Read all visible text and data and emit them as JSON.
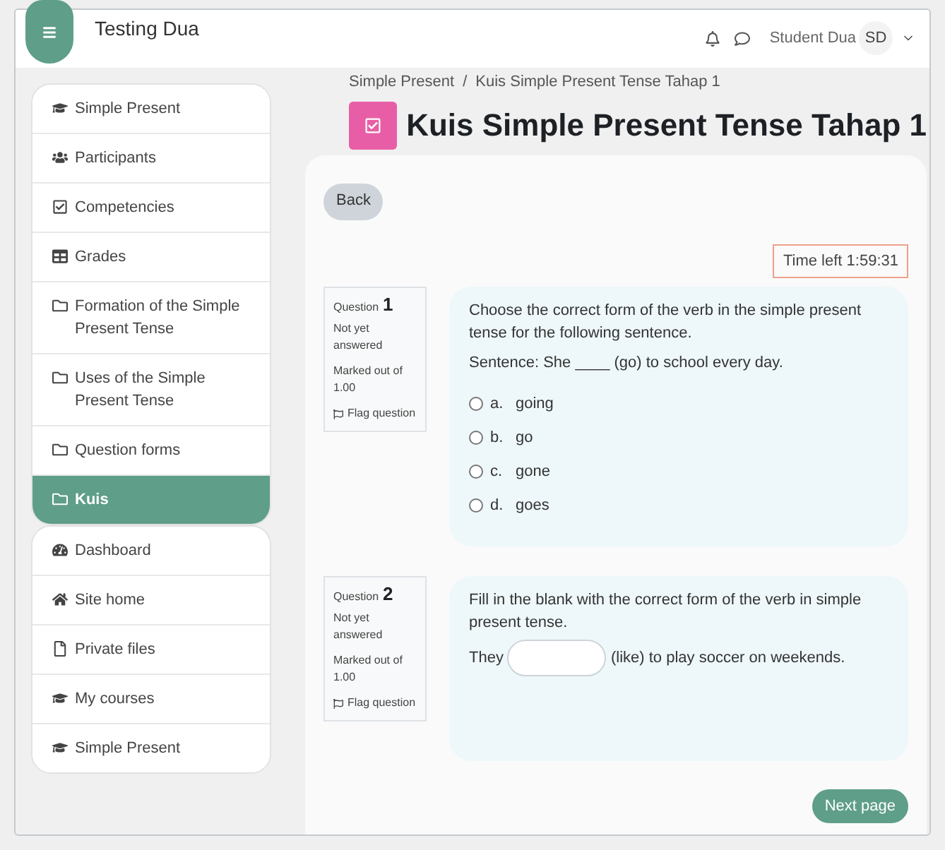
{
  "header": {
    "site_name": "Testing Dua",
    "user_name": "Student Dua",
    "user_initials": "SD"
  },
  "sidebar": {
    "course_items": [
      {
        "label": "Simple Present",
        "selected": false
      },
      {
        "label": "Participants",
        "selected": false
      },
      {
        "label": "Competencies",
        "selected": false
      },
      {
        "label": "Grades",
        "selected": false
      },
      {
        "label": "Formation of the Simple Present Tense",
        "selected": false
      },
      {
        "label": "Uses of the Simple Present Tense",
        "selected": false
      },
      {
        "label": "Question forms",
        "selected": false
      },
      {
        "label": "Kuis",
        "selected": true
      }
    ],
    "site_items": [
      {
        "label": "Dashboard",
        "selected": false
      },
      {
        "label": "Site home",
        "selected": false
      },
      {
        "label": "Private files",
        "selected": false
      },
      {
        "label": "My courses",
        "selected": false
      },
      {
        "label": "Simple Present",
        "selected": false
      }
    ]
  },
  "breadcrumb": [
    "Simple Present",
    "Kuis Simple Present Tense Tahap 1"
  ],
  "breadcrumb_separator": "/",
  "page_title": "Kuis Simple Present Tense Tahap 1",
  "back_button": "Back",
  "timer": "Time left 1:59:31",
  "questions": [
    {
      "kind": "choice",
      "label": "Question",
      "number": "1",
      "status": "Not yet answered",
      "marks": "Marked out of 1.00",
      "flag": "Flag question",
      "text": "Choose the correct form of the verb in the simple present tense for the following sentence.",
      "sentence": "Sentence: She ____ (go) to school every day.",
      "options": [
        {
          "letter": "a.",
          "text": "going",
          "selected": false
        },
        {
          "letter": "b.",
          "text": "go",
          "selected": false
        },
        {
          "letter": "c.",
          "text": "gone",
          "selected": false
        },
        {
          "letter": "d.",
          "text": "goes",
          "selected": false
        }
      ]
    },
    {
      "kind": "fill",
      "label": "Question",
      "number": "2",
      "status": "Not yet answered",
      "marks": "Marked out of 1.00",
      "flag": "Flag question",
      "text": "Fill in the blank with the correct form of the verb in simple present tense.",
      "before": "They",
      "after": "(like) to play soccer on weekends."
    }
  ],
  "next_button": "Next page"
}
